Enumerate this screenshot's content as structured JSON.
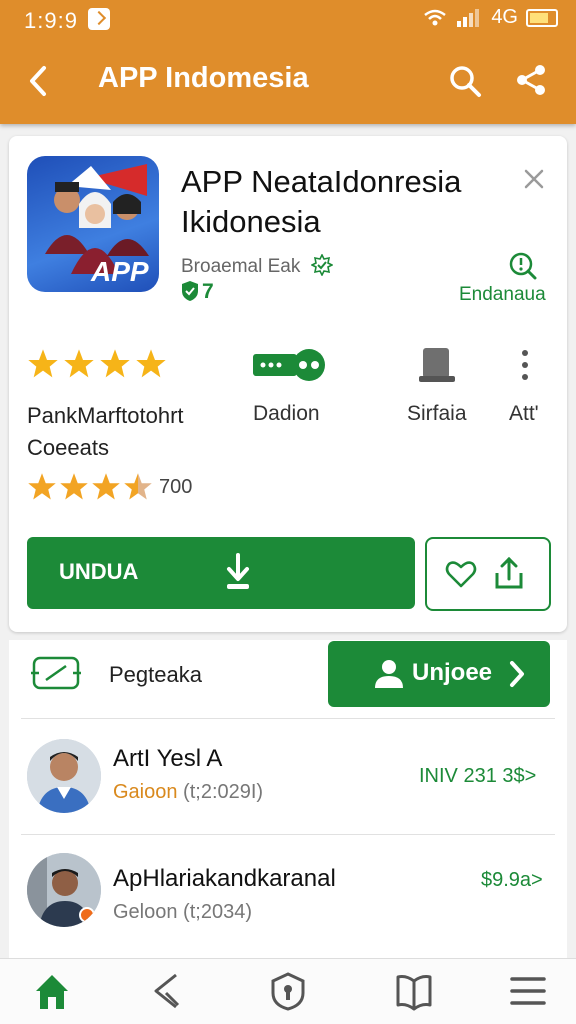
{
  "status_bar": {
    "time": "1:9:9",
    "network": "4G"
  },
  "app_bar": {
    "title": "APP Indomesia"
  },
  "app": {
    "name_line1": "APP NeataIdonresia",
    "name_line2": "Ikidonesia",
    "logo_text": "APP",
    "developer": "Broaemal Eak",
    "badge_count": "7",
    "info_label": "Endanaua"
  },
  "stats": {
    "rating_label_line1": "PankMarftotohrt",
    "rating_label_line2": "Coeeats",
    "review_count": "700",
    "data_label": "Dadion",
    "device_label": "Sirfaia",
    "more_label": "Att'",
    "top_stars": 4,
    "bottom_stars": 3.5
  },
  "actions": {
    "download_label": "UNDUA"
  },
  "promo": {
    "label": "Pegteaka",
    "update_label": "Unjoee"
  },
  "list_items": [
    {
      "name": "ArtI Yesl A",
      "sub_prefix": "Gaioon",
      "sub_suffix": " (t;2:029I)",
      "price": "INIV 231 3$>"
    },
    {
      "name": "ApHlariakandkaranal",
      "sub_prefix": "Geloon",
      "sub_suffix": " (t;2034)",
      "price": "$9.9a>"
    }
  ],
  "colors": {
    "orange": "#df8d2b",
    "green": "#1c8a38",
    "star": "#f6b418"
  },
  "icons": [
    "back-icon",
    "search-icon",
    "share-icon",
    "close-icon",
    "verified-icon",
    "shield-icon",
    "info-icon",
    "star-icon",
    "data-icon",
    "device-icon",
    "more-icon",
    "download-icon",
    "heart-icon",
    "upload-icon",
    "promo-icon",
    "home-icon",
    "back-nav-icon",
    "lock-icon",
    "book-icon",
    "menu-icon"
  ]
}
